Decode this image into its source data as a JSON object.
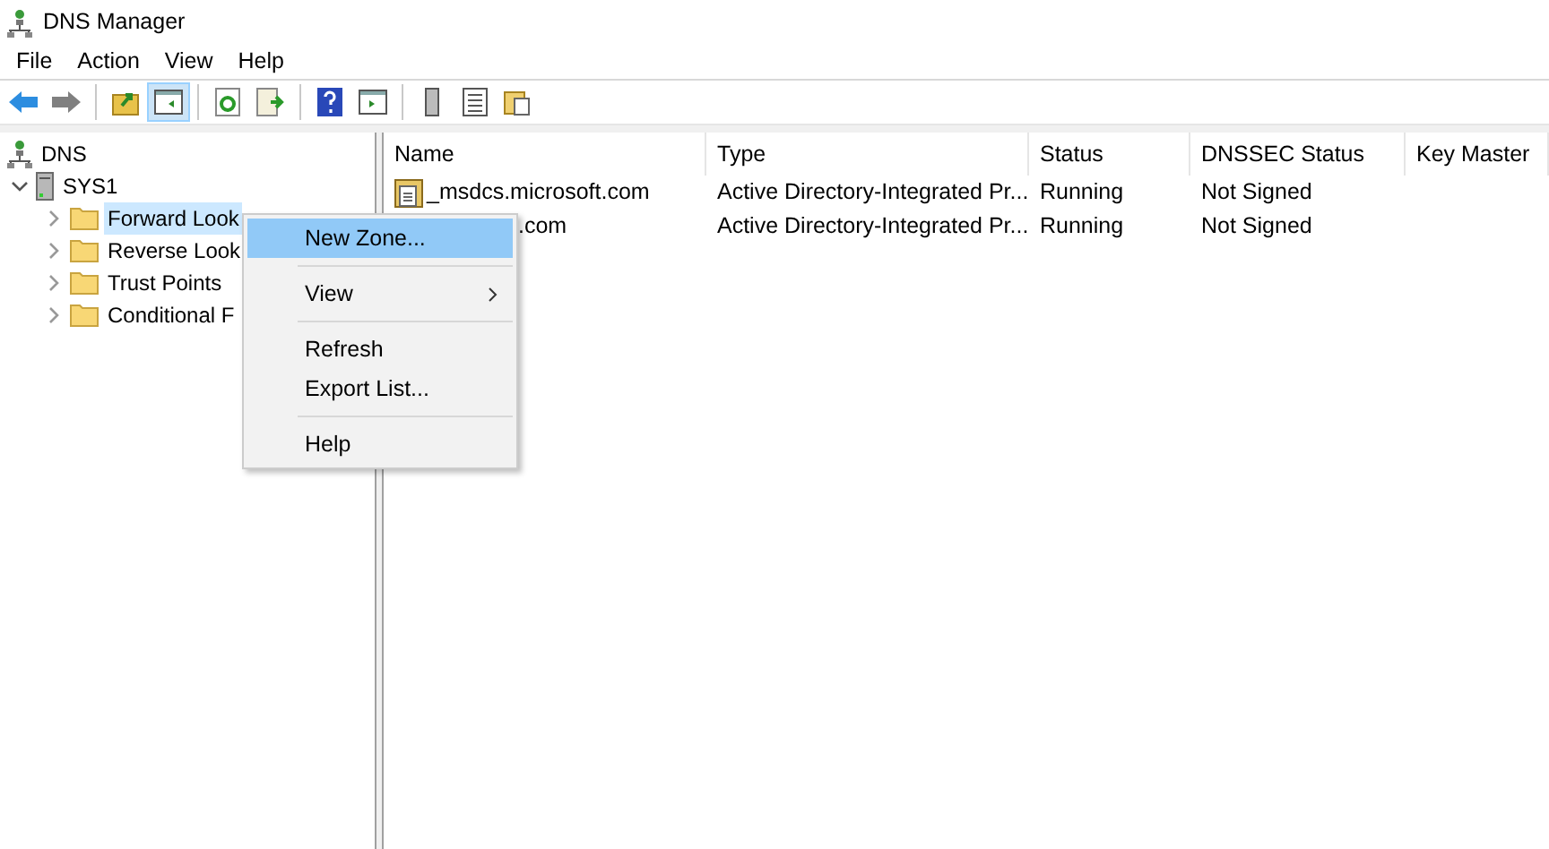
{
  "window": {
    "title": "DNS Manager"
  },
  "menu_bar": [
    "File",
    "Action",
    "View",
    "Help"
  ],
  "toolbar": [
    {
      "kind": "back",
      "selected": false
    },
    {
      "kind": "forward",
      "selected": false
    },
    {
      "kind": "sep"
    },
    {
      "kind": "up",
      "selected": false
    },
    {
      "kind": "pane",
      "selected": true
    },
    {
      "kind": "sep"
    },
    {
      "kind": "refresh",
      "selected": false
    },
    {
      "kind": "export",
      "selected": false
    },
    {
      "kind": "sep"
    },
    {
      "kind": "help",
      "selected": false
    },
    {
      "kind": "action",
      "selected": false
    },
    {
      "kind": "sep"
    },
    {
      "kind": "server",
      "selected": false
    },
    {
      "kind": "list",
      "selected": false
    },
    {
      "kind": "folders",
      "selected": false
    }
  ],
  "tree": [
    {
      "label": "DNS",
      "kind": "root",
      "selected": false,
      "children": [
        {
          "label": "SYS1",
          "kind": "server",
          "expanded": true,
          "selected": false,
          "children": [
            {
              "label": "Forward Look",
              "kind": "folder",
              "expanded": false,
              "selected": true
            },
            {
              "label": "Reverse Look",
              "kind": "folder",
              "expanded": false,
              "selected": false
            },
            {
              "label": "Trust Points",
              "kind": "folder",
              "expanded": false,
              "selected": false
            },
            {
              "label": "Conditional F",
              "kind": "folder",
              "expanded": false,
              "selected": false
            }
          ]
        }
      ]
    }
  ],
  "table": {
    "columns": [
      "Name",
      "Type",
      "Status",
      "DNSSEC Status",
      "Key Master"
    ],
    "rows": [
      {
        "partly_covered": false,
        "cells": [
          "_msdcs.microsoft.com",
          "Active Directory-Integrated Pr...",
          "Running",
          "Not Signed"
        ]
      },
      {
        "partly_covered": true,
        "cells": [
          ".com",
          "Active Directory-Integrated Pr...",
          "Running",
          "Not Signed"
        ]
      }
    ]
  },
  "context_menu": [
    {
      "kind": "item",
      "label": "New Zone...",
      "selected": true
    },
    {
      "kind": "sep"
    },
    {
      "kind": "submenu",
      "label": "View",
      "selected": false
    },
    {
      "kind": "sep"
    },
    {
      "kind": "item",
      "label": "Refresh",
      "selected": false
    },
    {
      "kind": "item",
      "label": "Export List...",
      "selected": false
    },
    {
      "kind": "sep"
    },
    {
      "kind": "item",
      "label": "Help",
      "selected": false
    }
  ]
}
